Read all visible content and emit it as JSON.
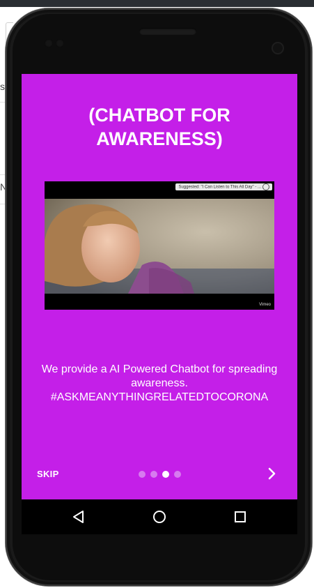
{
  "background": {
    "fragment_text_top": "s",
    "fragment_text_mid": "N"
  },
  "onboarding": {
    "title": "(CHATBOT FOR\nAWARENESS)",
    "video": {
      "suggestion_text": "Suggested: \"I Can Listen to This All Day\" - ...",
      "logo_text": "Vimeo"
    },
    "description": "We provide a AI Powered Chatbot for spreading awareness. #ASKMEANYTHINGRELATEDTOCORONA",
    "skip_label": "SKIP",
    "page_count": 4,
    "active_page": 3,
    "next_icon": "chevron-right-icon"
  },
  "colors": {
    "screen_background": "#c41fe8",
    "text": "#ffffff",
    "dot_inactive": "#d77bef",
    "dot_active": "#ffffff"
  },
  "android_nav": {
    "back_icon": "back-triangle-icon",
    "home_icon": "home-circle-icon",
    "recents_icon": "recents-square-icon"
  }
}
